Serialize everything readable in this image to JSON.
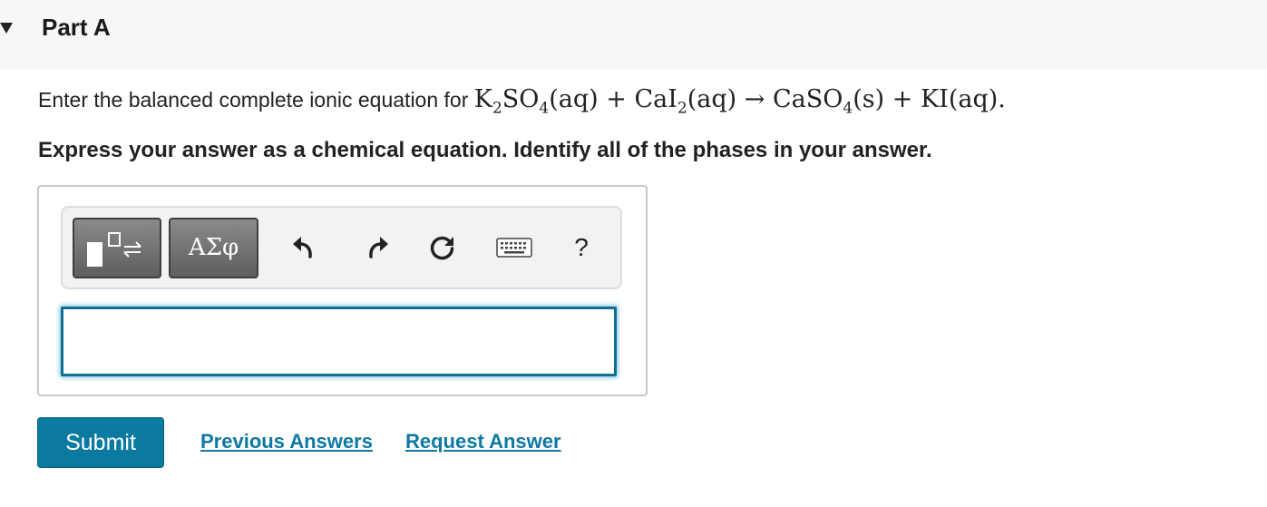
{
  "part": {
    "title": "Part A",
    "toggle_icon": "caret-down-icon"
  },
  "question": {
    "prompt_prefix": "Enter the balanced complete ionic equation for",
    "prompt_suffix": ".",
    "equation": {
      "k": "K",
      "k_sub": "2",
      "so": "SO",
      "so_sub": "4",
      "aq1": "(aq)",
      "plus1": "+",
      "cai": "CaI",
      "cai_sub": "2",
      "aq2": "(aq)",
      "arrow": "→",
      "caso": "CaSO",
      "caso_sub": "4",
      "s": "(s)",
      "plus2": "+",
      "ki": "KI(aq)"
    },
    "instruction": "Express your answer as a chemical equation. Identify all of the phases in your answer."
  },
  "toolbar": {
    "templates_icon": "templates-icon",
    "symbols_label": "ΑΣφ",
    "undo_icon": "undo-icon",
    "redo_icon": "redo-icon",
    "reset_icon": "reset-icon",
    "keyboard_icon": "keyboard-icon",
    "help_label": "?"
  },
  "answer": {
    "value": "",
    "placeholder": ""
  },
  "actions": {
    "submit_label": "Submit",
    "previous_answers_label": "Previous Answers",
    "request_answer_label": "Request Answer"
  },
  "colors": {
    "accent": "#0a7aa0",
    "link": "#0d78a3",
    "toolbar_button": "#6e6e6e",
    "header_bg": "#f7f7f7"
  }
}
